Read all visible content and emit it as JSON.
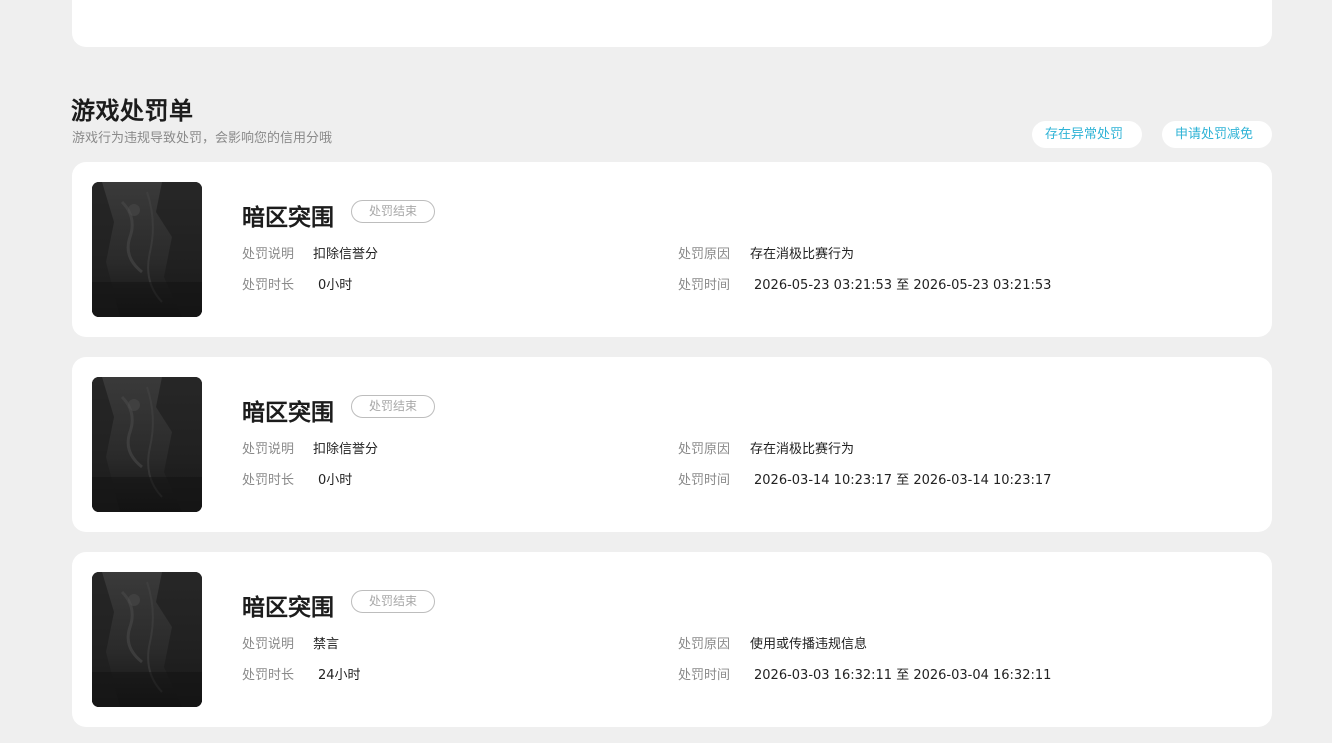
{
  "section": {
    "title": "游戏处罚单",
    "subtitle": "游戏行为违规导致处罚，会影响您的信用分哦"
  },
  "actions": {
    "anomaly_label": "存在异常处罚",
    "reduce_label": "申请处罚减免"
  },
  "records": [
    {
      "game": "暗区突围",
      "status": "处罚结束",
      "desc_label": "处罚说明",
      "desc_value": "扣除信誉分",
      "reason_label": "处罚原因",
      "reason_value": "存在消极比赛行为",
      "duration_label": "处罚时长",
      "duration_value": "0小时",
      "time_label": "处罚时间",
      "time_value": "2026-05-23 03:21:53 至 2026-05-23 03:21:53"
    },
    {
      "game": "暗区突围",
      "status": "处罚结束",
      "desc_label": "处罚说明",
      "desc_value": "扣除信誉分",
      "reason_label": "处罚原因",
      "reason_value": "存在消极比赛行为",
      "duration_label": "处罚时长",
      "duration_value": "0小时",
      "time_label": "处罚时间",
      "time_value": "2026-03-14 10:23:17 至 2026-03-14 10:23:17"
    },
    {
      "game": "暗区突围",
      "status": "处罚结束",
      "desc_label": "处罚说明",
      "desc_value": "禁言",
      "reason_label": "处罚原因",
      "reason_value": "使用或传播违规信息",
      "duration_label": "处罚时长",
      "duration_value": "24小时",
      "time_label": "处罚时间",
      "time_value": "2026-03-03 16:32:11 至 2026-03-04 16:32:11"
    }
  ],
  "colors": {
    "background": "#efefef",
    "card": "#ffffff",
    "accent": "#2fb3d6",
    "muted": "#8a8a8a",
    "text": "#222222"
  }
}
